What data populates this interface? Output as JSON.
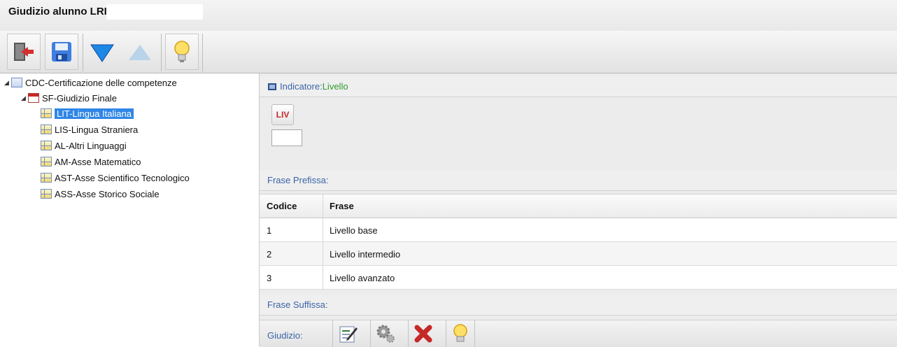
{
  "window": {
    "title": "Giudizio alunno LRICA L..."
  },
  "toolbar": {
    "buttons": [
      {
        "name": "exit",
        "icon": "exit-door-icon"
      },
      {
        "name": "save",
        "icon": "floppy-save-icon"
      },
      {
        "name": "move-down",
        "icon": "triangle-down-icon"
      },
      {
        "name": "move-up",
        "icon": "triangle-up-icon"
      },
      {
        "name": "hint",
        "icon": "lightbulb-icon"
      }
    ]
  },
  "tree": {
    "root": "CDC-Certificazione delle competenze",
    "child": "SF-Giudizio Finale",
    "items": [
      "LIT-Lingua Italiana",
      "LIS-Lingua Straniera",
      "AL-Altri Linguaggi",
      "AM-Asse Matematico",
      "AST-Asse Scientifico Tecnologico",
      "ASS-Asse Storico Sociale"
    ],
    "selected_index": 0
  },
  "indicator": {
    "label": "Indicatore:",
    "value": "Livello",
    "button_label": "LIV",
    "input_value": ""
  },
  "prefix": {
    "label": "Frase Prefissa:"
  },
  "table": {
    "headers": [
      "Codice",
      "Frase"
    ],
    "rows": [
      {
        "code": "1",
        "phrase": "Livello base"
      },
      {
        "code": "2",
        "phrase": "Livello intermedio"
      },
      {
        "code": "3",
        "phrase": "Livello avanzato"
      }
    ]
  },
  "suffix": {
    "label": "Frase Suffissa:"
  },
  "giudizio": {
    "label": "Giudizio:",
    "buttons": [
      {
        "name": "edit",
        "icon": "edit-pencil-icon"
      },
      {
        "name": "settings",
        "icon": "gears-icon"
      },
      {
        "name": "delete",
        "icon": "red-x-icon"
      },
      {
        "name": "hint",
        "icon": "lightbulb-icon"
      }
    ]
  },
  "colors": {
    "selection": "#2f86e6",
    "link_blue": "#3b63a8",
    "indicator_value": "#2e9c2e",
    "liv_red": "#c62828"
  }
}
